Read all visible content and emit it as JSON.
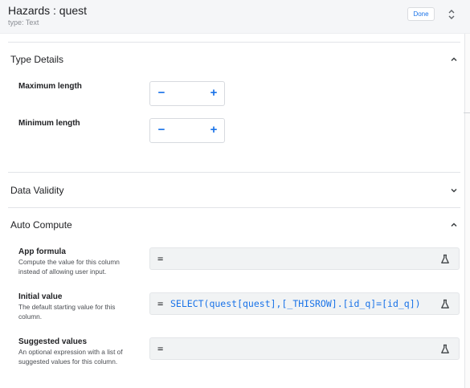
{
  "header": {
    "title": "Hazards : quest",
    "subtitle": "type: Text",
    "done_label": "Done",
    "expand_icon": "unfold-icon"
  },
  "type_details": {
    "title": "Type Details",
    "state": "expanded",
    "max_length": {
      "label": "Maximum length",
      "value": "",
      "minus": "−",
      "plus": "+"
    },
    "min_length": {
      "label": "Minimum length",
      "value": "",
      "minus": "−",
      "plus": "+"
    }
  },
  "data_validity": {
    "title": "Data Validity",
    "state": "collapsed"
  },
  "auto_compute": {
    "title": "Auto Compute",
    "state": "expanded",
    "app_formula": {
      "label": "App formula",
      "help": "Compute the value for this column instead of allowing user input.",
      "eq": "=",
      "value": ""
    },
    "initial_value": {
      "label": "Initial value",
      "help": "The default starting value for this column.",
      "eq": "=",
      "value": "SELECT(quest[quest],[_THISROW].[id_q]=[id_q])"
    },
    "suggested_values": {
      "label": "Suggested values",
      "help": "An optional expression with a list of suggested values for this column.",
      "eq": "=",
      "value": ""
    }
  },
  "colors": {
    "accent": "#1a73e8",
    "header_bg": "#f5f6f8",
    "expression_bg": "#f1f3f4"
  }
}
